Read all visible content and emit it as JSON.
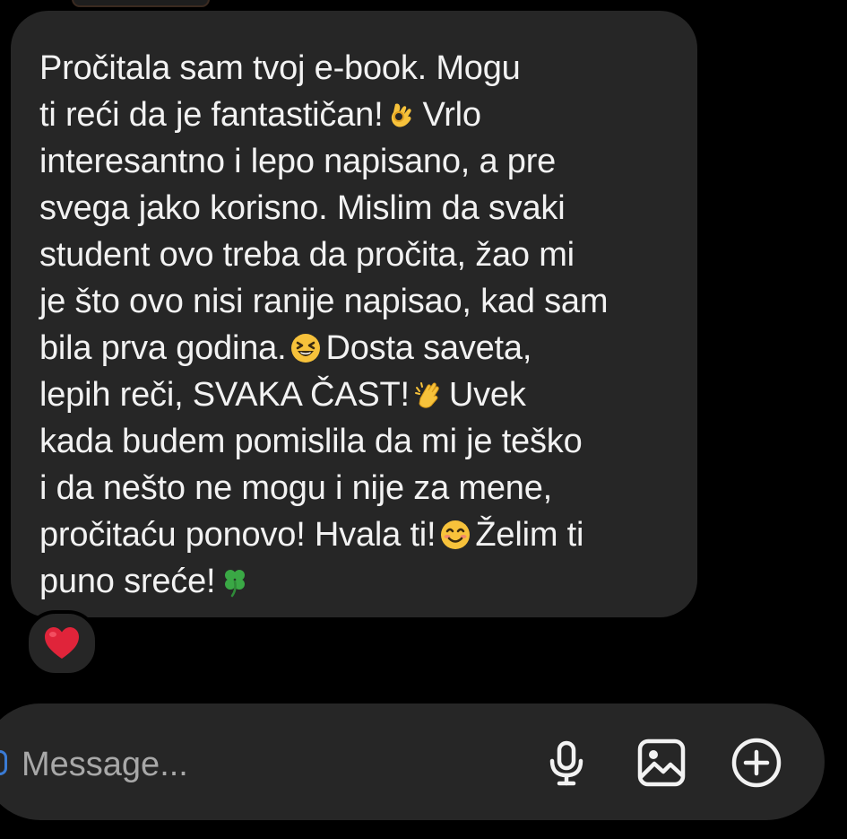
{
  "message": {
    "lines": [
      "Pročitala sam tvoj e-book. Mogu",
      "ti reći da je fantastičan!",
      "Vrlo",
      "interesantno i lepo napisano, a pre",
      "svega jako korisno. Mislim da svaki",
      "student ovo treba da pročita, žao mi",
      "je što ovo nisi ranije napisao, kad sam",
      "bila prva godina.",
      "Dosta saveta,",
      "lepih reči, SVAKA ČAST!",
      "Uvek",
      "kada budem pomislila da mi je teško",
      "i da nešto ne mogu i nije za mene,",
      "pročitaću ponovo! Hvala ti!",
      "Želim ti",
      "puno sreće!"
    ],
    "emojis": [
      "ok-hand-emoji",
      "laughing-emoji",
      "clapping-hands-emoji",
      "smiling-emoji",
      "four-leaf-clover-emoji"
    ]
  },
  "reaction": {
    "icon": "red-heart-icon",
    "color": "#e0243a"
  },
  "composer": {
    "placeholder": "Message...",
    "icons": [
      "microphone-icon",
      "image-icon",
      "add-circle-icon"
    ]
  },
  "colors": {
    "background": "#000000",
    "bubble": "#262626",
    "text": "#f2f2f2",
    "placeholder": "#a8a8a8"
  }
}
